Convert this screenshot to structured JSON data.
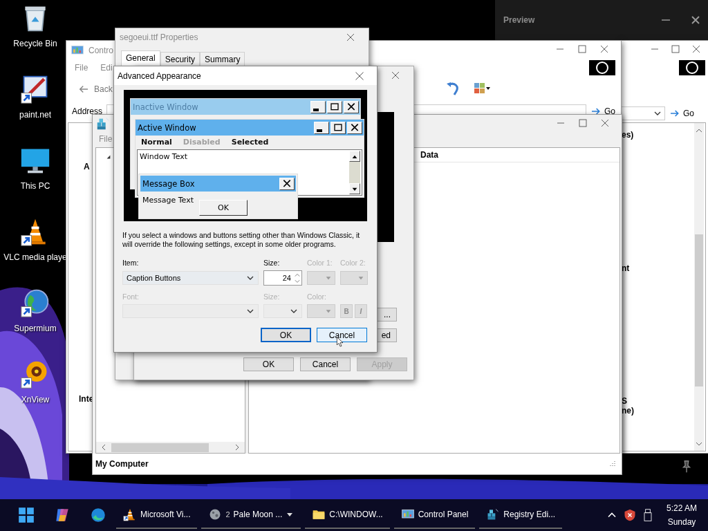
{
  "desktop_icons": [
    {
      "label": "Recycle Bin"
    },
    {
      "label": "paint.net"
    },
    {
      "label": "This PC"
    },
    {
      "label": "VLC media playe"
    },
    {
      "label": "Supermium"
    },
    {
      "label": "XnView"
    }
  ],
  "preview_window": {
    "title": "Preview"
  },
  "explorer_window": {
    "go": "Go",
    "fragments": [
      "es)",
      "nt",
      "S",
      "ne)"
    ]
  },
  "control_panel": {
    "title": "Contro",
    "menu": [
      "File",
      "Edi"
    ],
    "back": "Back",
    "address": "Address",
    "go": "Go",
    "tree_items": [
      "A",
      "Inte"
    ]
  },
  "registry_editor": {
    "menu": [
      "File"
    ],
    "column": "Data",
    "status": "My Computer"
  },
  "display_properties": {
    "side_buttons": [
      "...",
      "ed"
    ],
    "buttons": [
      {
        "label": "OK",
        "disabled": false
      },
      {
        "label": "Cancel",
        "disabled": false
      },
      {
        "label": "Apply",
        "disabled": true
      }
    ]
  },
  "font_properties": {
    "title": "segoeui.ttf Properties",
    "tabs": [
      {
        "label": "General",
        "selected": true
      },
      {
        "label": "Security",
        "selected": false
      },
      {
        "label": "Summary",
        "selected": false
      }
    ]
  },
  "advanced_appearance": {
    "title": "Advanced Appearance",
    "preview": {
      "inactive_title": "Inactive Window",
      "active_title": "Active Window",
      "menu": [
        {
          "label": "Normal",
          "disabled": false
        },
        {
          "label": "Disabled",
          "disabled": true
        },
        {
          "label": "Selected",
          "disabled": false
        }
      ],
      "window_text": "Window Text",
      "message_title": "Message Box",
      "message_text": "Message Text",
      "message_button": "OK"
    },
    "note": "If you select a windows and buttons setting other than Windows Classic, it will override the following settings, except in some older programs.",
    "item": {
      "label": "Item:",
      "value": "Caption Buttons"
    },
    "size": {
      "label": "Size:",
      "value": "24"
    },
    "color1": {
      "label": "Color 1:",
      "disabled": true
    },
    "color2": {
      "label": "Color 2:",
      "disabled": true
    },
    "font": {
      "label": "Font:",
      "disabled": true
    },
    "font_size": {
      "label": "Size:",
      "disabled": true
    },
    "font_color": {
      "label": "Color:",
      "disabled": true
    },
    "bold_button": {
      "label": "B",
      "disabled": true
    },
    "italic_button": {
      "label": "I",
      "disabled": true
    },
    "buttons": [
      {
        "label": "OK",
        "default": true
      },
      {
        "label": "Cancel",
        "default": false
      }
    ]
  },
  "taskbar": {
    "apps": [
      {
        "label": "Microsoft Vi..."
      },
      {
        "count": "2",
        "label": "Pale Moon ...",
        "menu": true
      },
      {
        "label": "C:\\WINDOW..."
      },
      {
        "label": "Control Panel"
      },
      {
        "label": "Registry Edi..."
      }
    ],
    "time": "5:22 AM",
    "day": "Sunday"
  }
}
